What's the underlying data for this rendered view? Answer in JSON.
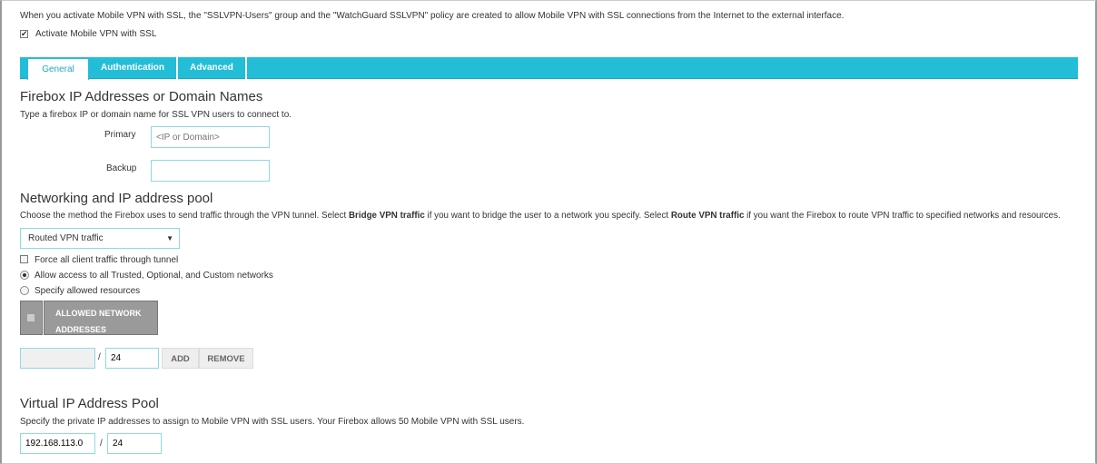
{
  "intro": "When you activate Mobile VPN with SSL, the \"SSLVPN-Users\" group and the \"WatchGuard SSLVPN\" policy are created to allow Mobile VPN with SSL connections from the Internet to the external interface.",
  "activate": {
    "label": "Activate Mobile VPN with SSL",
    "checked": true
  },
  "tabs": [
    {
      "label": "General",
      "active": true
    },
    {
      "label": "Authentication"
    },
    {
      "label": "Advanced"
    }
  ],
  "firebox": {
    "title": "Firebox IP Addresses or Domain Names",
    "desc": "Type a firebox IP or domain name for SSL VPN users to connect to.",
    "primary_label": "Primary",
    "primary_placeholder": "<IP or Domain>",
    "backup_label": "Backup",
    "backup_value": ""
  },
  "networking": {
    "title": "Networking and IP address pool",
    "desc_1": "Choose the method the Firebox uses to send traffic through the VPN tunnel. Select ",
    "bold_1": "Bridge VPN traffic",
    "desc_2": " if you want to bridge the user to a network you specify. Select ",
    "bold_2": "Route VPN traffic",
    "desc_3": " if you want the Firebox to route VPN traffic to specified networks and resources.",
    "method": "Routed VPN traffic",
    "force_label": "Force all client traffic through tunnel",
    "force_checked": false,
    "allow_all_label": "Allow access to all Trusted, Optional, and Custom networks",
    "specify_label": "Specify allowed resources",
    "selected_option": "allow_all",
    "table_header_1": "ALLOWED NETWORK",
    "table_header_2": "ADDRESSES",
    "network_value": "",
    "mask_value": "24",
    "slash": "/",
    "add": "ADD",
    "remove": "REMOVE"
  },
  "pool": {
    "title": "Virtual IP Address Pool",
    "desc": "Specify the private IP addresses to assign to Mobile VPN with SSL users. Your Firebox allows 50 Mobile VPN with SSL users.",
    "ip": "192.168.113.0",
    "slash": "/",
    "mask": "24"
  },
  "colors": {
    "accent": "#23bdd8",
    "table_header": "#9a9a9a"
  }
}
